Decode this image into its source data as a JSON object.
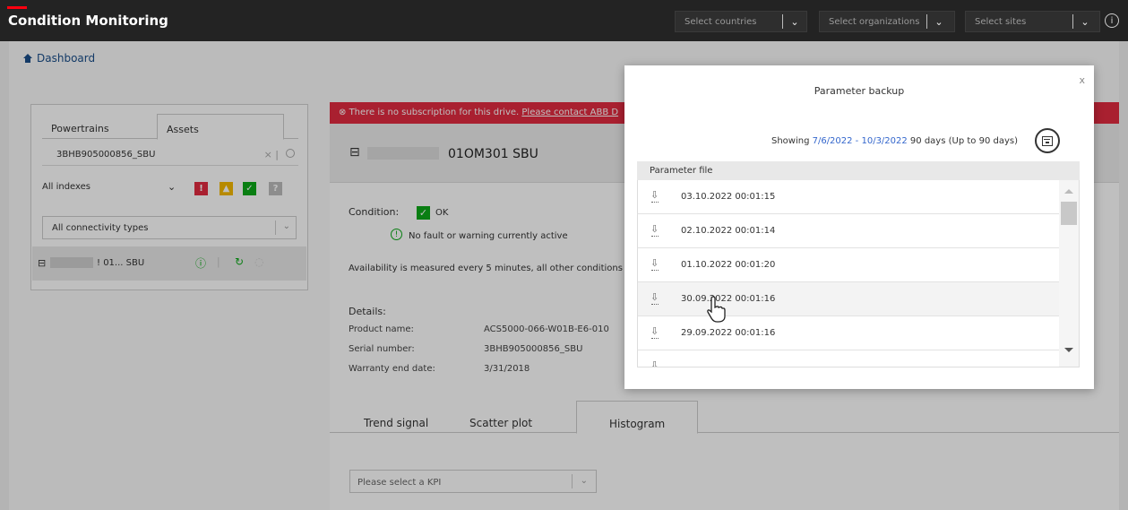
{
  "app": {
    "title": "Condition Monitoring"
  },
  "topbar": {
    "countries_placeholder": "Select countries",
    "organizations_placeholder": "Select organizations",
    "sites_placeholder": "Select sites",
    "chevron": "⌄",
    "info": "i"
  },
  "breadcrumb": {
    "dashboard": "Dashboard"
  },
  "left_panel": {
    "tabs": [
      "Powertrains",
      "Assets"
    ],
    "search_value": "3BHB905000856_SBU",
    "index_filter": "All indexes",
    "index_badges": [
      {
        "symbol": "!",
        "color": "#e22b40"
      },
      {
        "symbol": "▲",
        "color": "#f5b800"
      },
      {
        "symbol": "✓",
        "color": "#0ca919"
      },
      {
        "symbol": "?",
        "color": "#bdbdbd"
      }
    ],
    "connectivity": "All connectivity types",
    "asset_name": "! 01... SBU"
  },
  "alert": {
    "text": "There is no subscription for this drive. ",
    "link": "Please contact ABB D"
  },
  "drive": {
    "title": "01OM301 SBU",
    "condition_label": "Condition:",
    "condition_value": "OK",
    "fault_text": "No fault or warning currently active",
    "availability_text": "Availability is measured every 5 minutes, all other conditions o",
    "details_heading": "Details:",
    "details": [
      {
        "label": "Product name:",
        "value": "ACS5000-066-W01B-E6-010"
      },
      {
        "label": "Serial number:",
        "value": "3BHB905000856_SBU"
      },
      {
        "label": "Warranty end date:",
        "value": "3/31/2018"
      }
    ],
    "tabs": [
      "Trend signal",
      "Scatter plot",
      "Histogram"
    ],
    "kpi_placeholder": "Please select a KPI"
  },
  "modal": {
    "title": "Parameter backup",
    "close": "x",
    "showing_prefix": "Showing ",
    "showing_dates": "7/6/2022 - 10/3/2022",
    "showing_suffix": " 90 days (Up to 90 days)",
    "column_header": "Parameter file",
    "files": [
      "03.10.2022 00:01:15",
      "02.10.2022 00:01:14",
      "01.10.2022 00:01:20",
      "30.09.2022 00:01:16",
      "29.09.2022 00:01:16"
    ]
  }
}
